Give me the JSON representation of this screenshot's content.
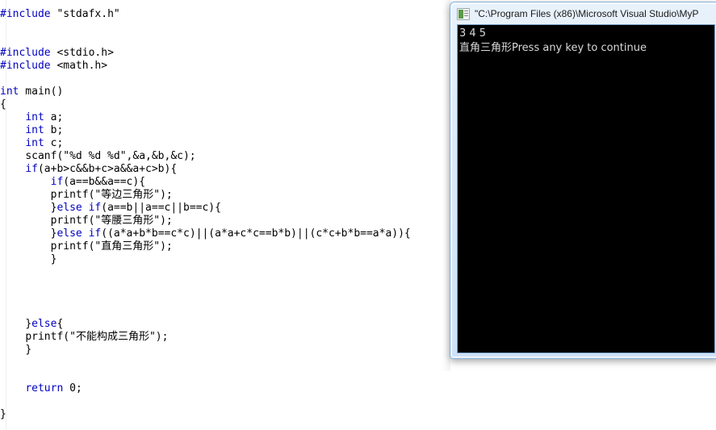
{
  "editor": {
    "name": "visual-studio-code-editor",
    "language": "C",
    "keyword_color": "#0000c0",
    "text_color": "#000000",
    "background_color": "#ffffff",
    "lines": [
      {
        "indent": 0,
        "tokens": [
          {
            "t": "#include",
            "c": "pre"
          },
          {
            "t": " \"stdafx.h\"",
            "c": "txt"
          }
        ]
      },
      {
        "indent": 0,
        "tokens": []
      },
      {
        "indent": 0,
        "tokens": []
      },
      {
        "indent": 0,
        "tokens": [
          {
            "t": "#include",
            "c": "pre"
          },
          {
            "t": " <stdio.h>",
            "c": "txt"
          }
        ]
      },
      {
        "indent": 0,
        "tokens": [
          {
            "t": "#include",
            "c": "pre"
          },
          {
            "t": " <math.h>",
            "c": "txt"
          }
        ]
      },
      {
        "indent": 0,
        "tokens": []
      },
      {
        "indent": 0,
        "tokens": [
          {
            "t": "int",
            "c": "kw"
          },
          {
            "t": " main()",
            "c": "txt"
          }
        ]
      },
      {
        "indent": 0,
        "tokens": [
          {
            "t": "{",
            "c": "txt"
          }
        ]
      },
      {
        "indent": 4,
        "tokens": [
          {
            "t": "int",
            "c": "kw"
          },
          {
            "t": " a;",
            "c": "txt"
          }
        ]
      },
      {
        "indent": 4,
        "tokens": [
          {
            "t": "int",
            "c": "kw"
          },
          {
            "t": " b;",
            "c": "txt"
          }
        ]
      },
      {
        "indent": 4,
        "tokens": [
          {
            "t": "int",
            "c": "kw"
          },
          {
            "t": " c;",
            "c": "txt"
          }
        ]
      },
      {
        "indent": 4,
        "tokens": [
          {
            "t": "scanf(\"%d %d %d\",&a,&b,&c);",
            "c": "txt"
          }
        ]
      },
      {
        "indent": 4,
        "tokens": [
          {
            "t": "if",
            "c": "kw"
          },
          {
            "t": "(a+b>c&&b+c>a&&a+c>b){",
            "c": "txt"
          }
        ]
      },
      {
        "indent": 8,
        "tokens": [
          {
            "t": "if",
            "c": "kw"
          },
          {
            "t": "(a==b&&a==c){",
            "c": "txt"
          }
        ]
      },
      {
        "indent": 8,
        "tokens": [
          {
            "t": "printf(\"",
            "c": "txt"
          },
          {
            "t": "等边三角形",
            "c": "cn"
          },
          {
            "t": "\");",
            "c": "txt"
          }
        ]
      },
      {
        "indent": 8,
        "tokens": [
          {
            "t": "}",
            "c": "txt"
          },
          {
            "t": "else",
            "c": "kw"
          },
          {
            "t": " ",
            "c": "txt"
          },
          {
            "t": "if",
            "c": "kw"
          },
          {
            "t": "(a==b||a==c||b==c){",
            "c": "txt"
          }
        ]
      },
      {
        "indent": 8,
        "tokens": [
          {
            "t": "printf(\"",
            "c": "txt"
          },
          {
            "t": "等腰三角形",
            "c": "cn"
          },
          {
            "t": "\");",
            "c": "txt"
          }
        ]
      },
      {
        "indent": 8,
        "tokens": [
          {
            "t": "}",
            "c": "txt"
          },
          {
            "t": "else",
            "c": "kw"
          },
          {
            "t": " ",
            "c": "txt"
          },
          {
            "t": "if",
            "c": "kw"
          },
          {
            "t": "((a*a+b*b==c*c)||(a*a+c*c==b*b)||(c*c+b*b==a*a)){",
            "c": "txt"
          }
        ]
      },
      {
        "indent": 8,
        "tokens": [
          {
            "t": "printf(\"",
            "c": "txt"
          },
          {
            "t": "直角三角形",
            "c": "cn"
          },
          {
            "t": "\");",
            "c": "txt"
          }
        ]
      },
      {
        "indent": 8,
        "tokens": [
          {
            "t": "}",
            "c": "txt"
          }
        ]
      },
      {
        "indent": 0,
        "tokens": []
      },
      {
        "indent": 0,
        "tokens": []
      },
      {
        "indent": 0,
        "tokens": []
      },
      {
        "indent": 0,
        "tokens": []
      },
      {
        "indent": 4,
        "tokens": [
          {
            "t": "}",
            "c": "txt"
          },
          {
            "t": "else",
            "c": "kw"
          },
          {
            "t": "{",
            "c": "txt"
          }
        ]
      },
      {
        "indent": 4,
        "tokens": [
          {
            "t": "printf(\"",
            "c": "txt"
          },
          {
            "t": "不能构成三角形",
            "c": "cn"
          },
          {
            "t": "\");",
            "c": "txt"
          }
        ]
      },
      {
        "indent": 4,
        "tokens": [
          {
            "t": "}",
            "c": "txt"
          }
        ]
      },
      {
        "indent": 0,
        "tokens": []
      },
      {
        "indent": 0,
        "tokens": []
      },
      {
        "indent": 4,
        "tokens": [
          {
            "t": "return",
            "c": "kw"
          },
          {
            "t": " 0;",
            "c": "txt"
          }
        ]
      },
      {
        "indent": 0,
        "tokens": []
      },
      {
        "indent": 0,
        "tokens": [
          {
            "t": "}",
            "c": "txt"
          }
        ]
      }
    ]
  },
  "console_window": {
    "title": "\"C:\\Program Files (x86)\\Microsoft Visual Studio\\MyP",
    "icon": "console-window-icon",
    "background_color": "#000000",
    "text_color": "#d9d9d9",
    "output_lines": [
      "3 4 5",
      "直角三角形Press any key to continue"
    ]
  }
}
